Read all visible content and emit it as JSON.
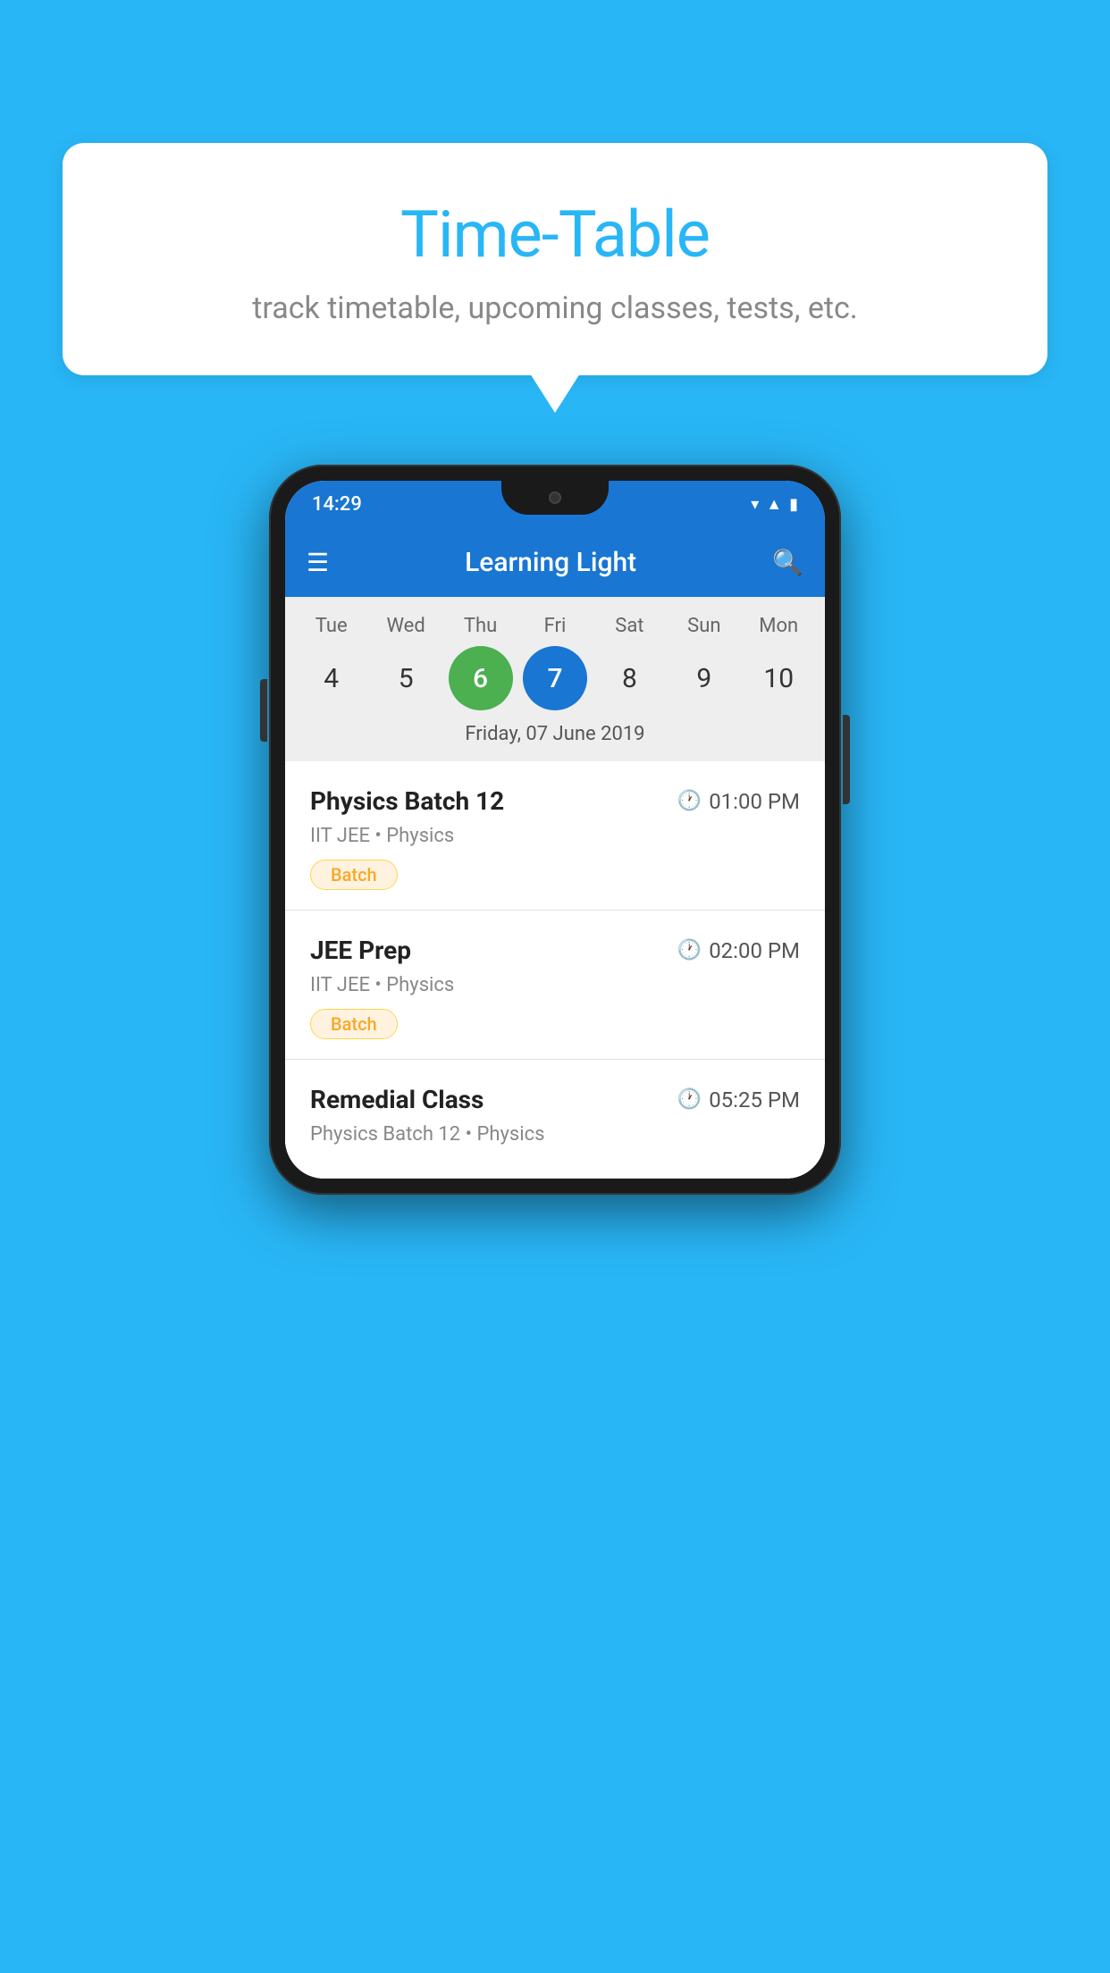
{
  "background_color": "#29B6F6",
  "bubble": {
    "title": "Time-Table",
    "subtitle": "track timetable, upcoming classes, tests, etc."
  },
  "phone": {
    "status_bar": {
      "time": "14:29",
      "icons": [
        "wifi",
        "signal",
        "battery"
      ]
    },
    "app_bar": {
      "title": "Learning Light",
      "menu_icon": "☰",
      "search_icon": "🔍"
    },
    "calendar": {
      "days": [
        {
          "label": "Tue",
          "num": "4",
          "state": "normal"
        },
        {
          "label": "Wed",
          "num": "5",
          "state": "normal"
        },
        {
          "label": "Thu",
          "num": "6",
          "state": "today"
        },
        {
          "label": "Fri",
          "num": "7",
          "state": "selected"
        },
        {
          "label": "Sat",
          "num": "8",
          "state": "normal"
        },
        {
          "label": "Sun",
          "num": "9",
          "state": "normal"
        },
        {
          "label": "Mon",
          "num": "10",
          "state": "normal"
        }
      ],
      "selected_date_label": "Friday, 07 June 2019"
    },
    "classes": [
      {
        "name": "Physics Batch 12",
        "time": "01:00 PM",
        "detail": "IIT JEE • Physics",
        "badge": "Batch"
      },
      {
        "name": "JEE Prep",
        "time": "02:00 PM",
        "detail": "IIT JEE • Physics",
        "badge": "Batch"
      },
      {
        "name": "Remedial Class",
        "time": "05:25 PM",
        "detail": "Physics Batch 12 • Physics",
        "badge": null
      }
    ]
  }
}
